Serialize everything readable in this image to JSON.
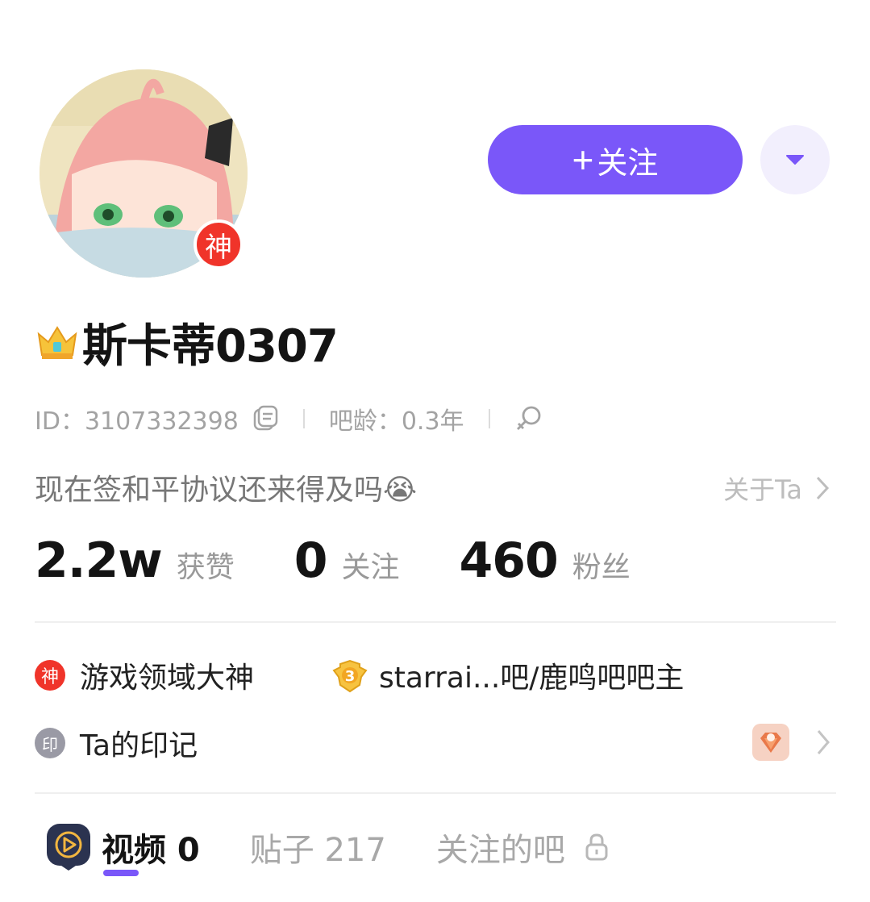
{
  "profile": {
    "name": "斯卡蒂0307",
    "god_badge": "神",
    "id_label": "ID：3107332398",
    "age_label": "吧龄：0.3年",
    "bio": "现在签和平协议还来得及吗😭",
    "about_label": "关于Ta"
  },
  "actions": {
    "follow_plus": "+",
    "follow_label": "关注"
  },
  "stats": [
    {
      "value": "2.2w",
      "label": "获赞"
    },
    {
      "value": "0",
      "label": "关注"
    },
    {
      "value": "460",
      "label": "粉丝"
    }
  ],
  "honors": {
    "god_icon": "神",
    "god_label": "游戏领域大神",
    "level": "3",
    "bar_label": "starrai...吧/鹿鸣吧吧主",
    "imprint_icon": "印",
    "imprint_label": "Ta的印记"
  },
  "tabs": [
    {
      "label": "视频 0"
    },
    {
      "label": "贴子 217"
    },
    {
      "label": "关注的吧"
    }
  ],
  "colors": {
    "accent": "#7a57f9",
    "god_red": "#f0342a",
    "muted": "#a3a3a3"
  }
}
